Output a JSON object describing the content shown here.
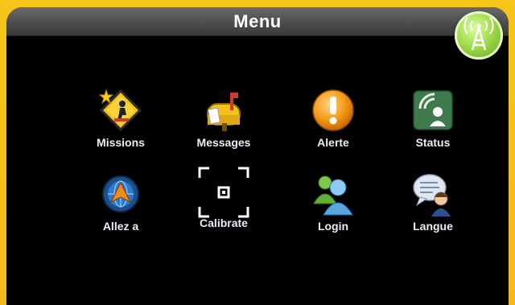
{
  "header": {
    "title": "Menu"
  },
  "menu": {
    "items": [
      {
        "label": "Missions",
        "icon": "missions-roadwork-icon"
      },
      {
        "label": "Messages",
        "icon": "mailbox-icon"
      },
      {
        "label": "Alerte",
        "icon": "alert-icon"
      },
      {
        "label": "Status",
        "icon": "status-signal-icon"
      },
      {
        "label": "Allez a",
        "icon": "navigate-globe-icon"
      },
      {
        "label": "Calibrate",
        "icon": "calibrate-icon"
      },
      {
        "label": "Login",
        "icon": "users-login-icon"
      },
      {
        "label": "Langue",
        "icon": "language-chat-icon"
      }
    ]
  },
  "status": {
    "icon": "signal-tower-icon"
  },
  "colors": {
    "frame": "#f5c518",
    "background": "#000000",
    "label": "#e8eef6",
    "signal": "#9ed94b"
  }
}
